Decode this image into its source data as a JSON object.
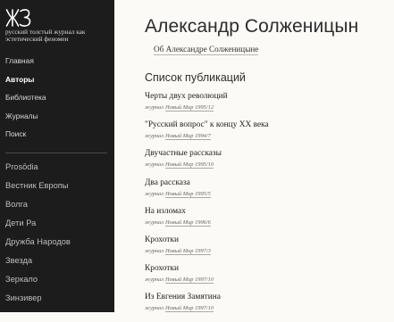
{
  "brand": {
    "logo_text": "ЖЗ",
    "tagline": "русский толстый журнал как эстетический феномен"
  },
  "nav": {
    "items": [
      {
        "label": "Главная"
      },
      {
        "label": "Авторы",
        "active": true
      },
      {
        "label": "Библиотека"
      },
      {
        "label": "Журналы"
      },
      {
        "label": "Поиск"
      }
    ]
  },
  "journals": {
    "items": [
      {
        "label": "Prosōdia"
      },
      {
        "label": "Вестник Европы"
      },
      {
        "label": "Волга"
      },
      {
        "label": "Дети Ра"
      },
      {
        "label": "Дружба Народов"
      },
      {
        "label": "Звезда"
      },
      {
        "label": "Зеркало"
      },
      {
        "label": "Зинзивер"
      }
    ]
  },
  "main": {
    "author_name": "Александр Солженицын",
    "about_link": "Об Александре Солженицыне",
    "publications_heading": "Список публикаций",
    "publications": [
      {
        "title": "Черты двух революций",
        "meta_label": "журнал",
        "issue": "Новый Мир 1995/12"
      },
      {
        "title": "\"Русский вопрос\" к концу XX века",
        "meta_label": "журнал",
        "issue": "Новый Мир 1994/7"
      },
      {
        "title": "Двучастные рассказы",
        "meta_label": "журнал",
        "issue": "Новый Мир 1995/10"
      },
      {
        "title": "Два рассказа",
        "meta_label": "журнал",
        "issue": "Новый Мир 1995/5"
      },
      {
        "title": "На изломах",
        "meta_label": "журнал",
        "issue": "Новый Мир 1996/6"
      },
      {
        "title": "Крохотки",
        "meta_label": "журнал",
        "issue": "Новый Мир 1997/3"
      },
      {
        "title": "Крохотки",
        "meta_label": "журнал",
        "issue": "Новый Мир 1997/10"
      },
      {
        "title": "Из Евгения Замятина",
        "meta_label": "журнал",
        "issue": "Новый Мир 1997/10"
      }
    ]
  },
  "colors": {
    "sidebar_bg": "#1c1c1c",
    "page_bg": "#fbfaf6",
    "text": "#2b2b2b"
  }
}
